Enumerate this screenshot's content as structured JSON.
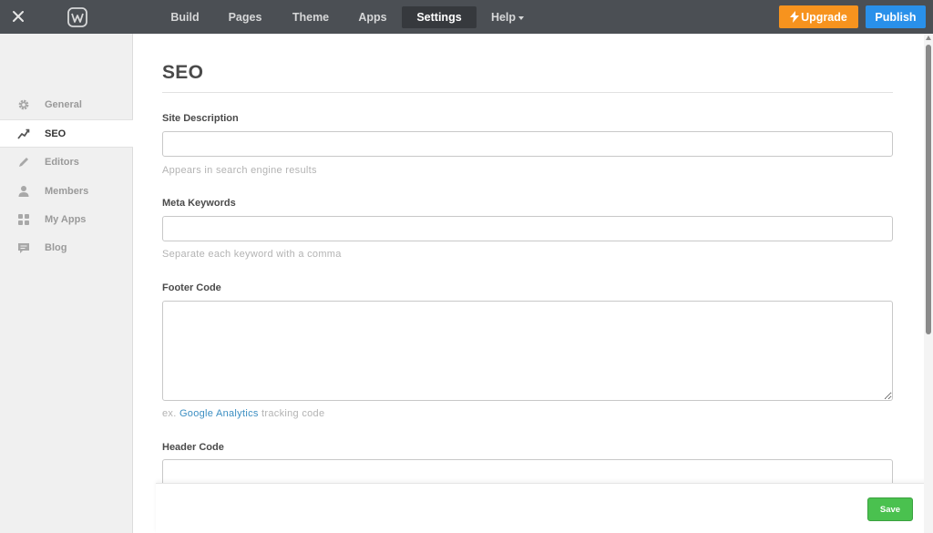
{
  "topbar": {
    "nav": [
      {
        "label": "Build"
      },
      {
        "label": "Pages"
      },
      {
        "label": "Theme"
      },
      {
        "label": "Apps"
      },
      {
        "label": "Settings"
      },
      {
        "label": "Help"
      }
    ],
    "active_nav": "Settings",
    "upgrade_label": "Upgrade",
    "publish_label": "Publish",
    "colors": {
      "bar": "#4b4f54",
      "upgrade": "#f7931e",
      "publish": "#2990ea"
    }
  },
  "sidebar": {
    "items": [
      {
        "label": "General",
        "icon": "gear-icon"
      },
      {
        "label": "SEO",
        "icon": "trend-icon"
      },
      {
        "label": "Editors",
        "icon": "pencil-icon"
      },
      {
        "label": "Members",
        "icon": "person-icon"
      },
      {
        "label": "My Apps",
        "icon": "grid-icon"
      },
      {
        "label": "Blog",
        "icon": "comment-icon"
      }
    ],
    "active_item": "SEO"
  },
  "main": {
    "title": "SEO",
    "fields": {
      "site_description": {
        "label": "Site Description",
        "value": "",
        "help": "Appears in search engine results"
      },
      "meta_keywords": {
        "label": "Meta Keywords",
        "value": "",
        "help": "Separate each keyword with a comma"
      },
      "footer_code": {
        "label": "Footer Code",
        "value": "",
        "help_prefix": "ex.",
        "help_link": "Google Analytics",
        "help_suffix": "tracking code"
      },
      "header_code": {
        "label": "Header Code",
        "value": ""
      }
    }
  },
  "savebar": {
    "save_label": "Save",
    "color": "#4ac14f"
  }
}
